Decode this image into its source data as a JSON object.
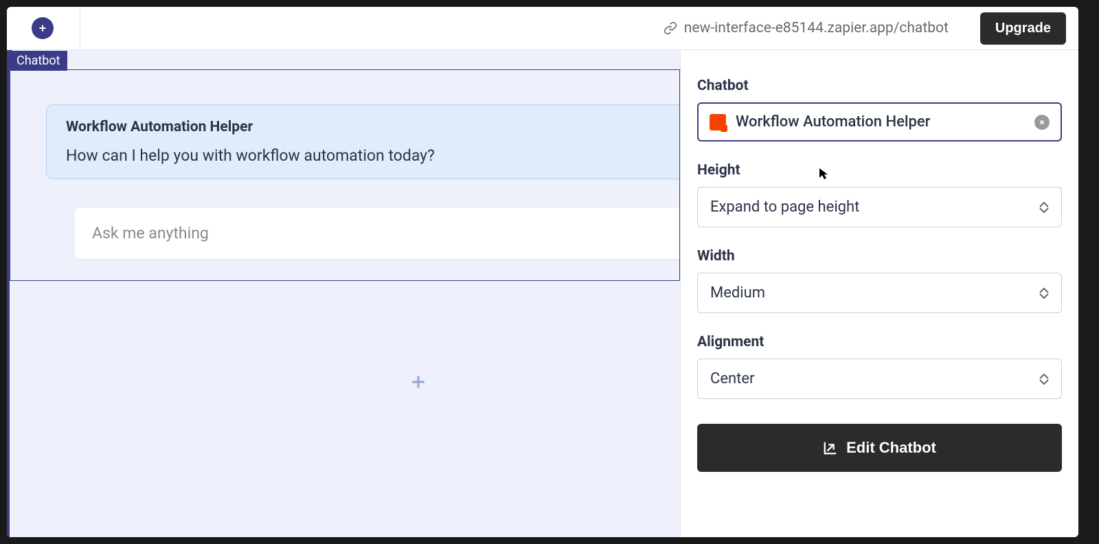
{
  "topbar": {
    "url": "new-interface-e85144.zapier.app/chatbot",
    "upgrade_label": "Upgrade"
  },
  "canvas": {
    "block_tag": "Chatbot",
    "chat_title": "Workflow Automation Helper",
    "chat_greeting": "How can I help you with workflow automation today?",
    "input_placeholder": "Ask me anything"
  },
  "sidepanel": {
    "chatbot_label": "Chatbot",
    "chatbot_value": "Workflow Automation Helper",
    "height_label": "Height",
    "height_value": "Expand to page height",
    "width_label": "Width",
    "width_value": "Medium",
    "align_label": "Alignment",
    "align_value": "Center",
    "edit_label": "Edit Chatbot"
  }
}
